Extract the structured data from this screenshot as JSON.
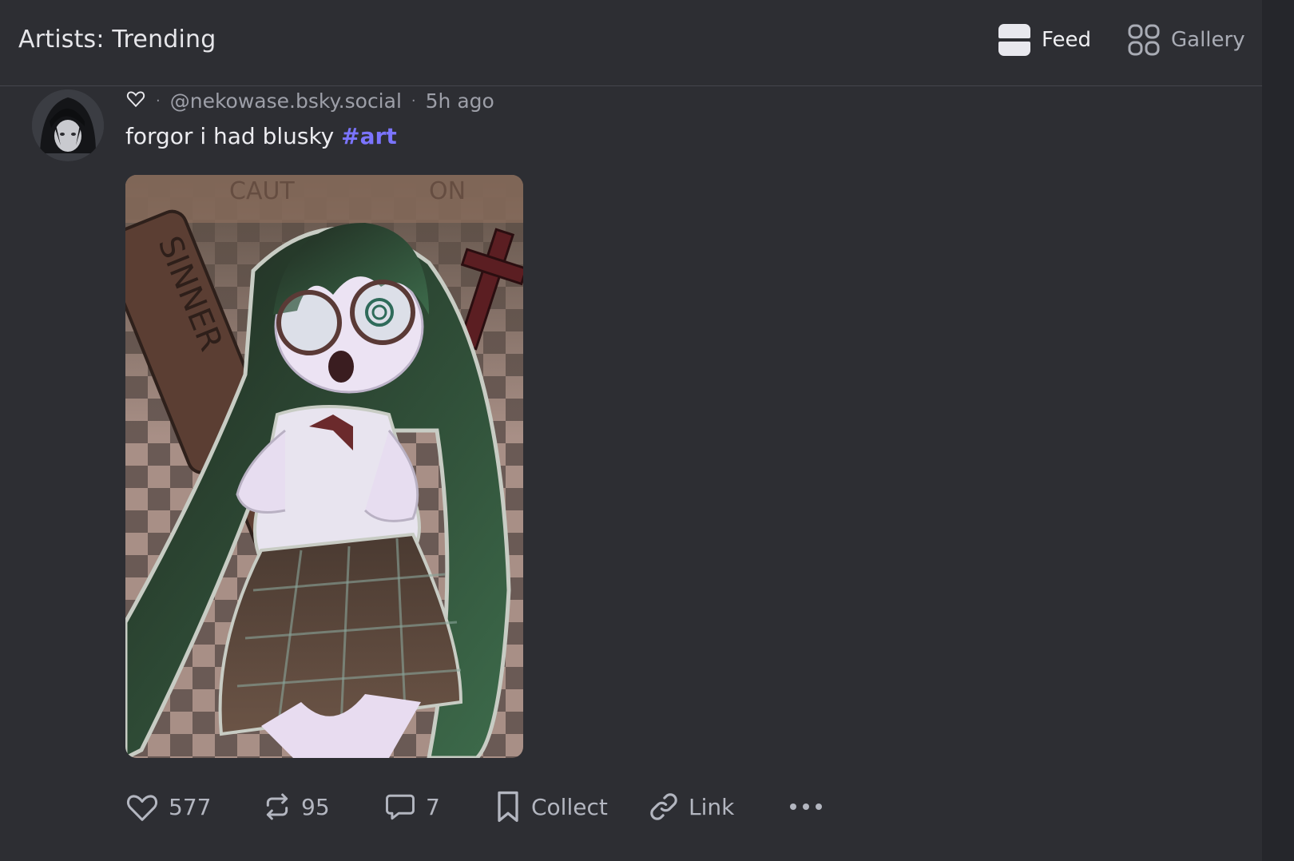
{
  "header": {
    "title": "Artists: Trending",
    "tabs": [
      {
        "label": "Feed",
        "icon": "feed-icon",
        "active": true
      },
      {
        "label": "Gallery",
        "icon": "gallery-icon",
        "active": false
      }
    ]
  },
  "post": {
    "avatar_icon": "avatar",
    "display_name_icon": "heart-outline-icon",
    "handle": "@nekowase.bsky.social",
    "separator": "·",
    "time": "5h ago",
    "text": "forgor i had blusky",
    "hashtag": "#art",
    "image_icon": "illustration",
    "actions": {
      "like_count": "577",
      "repost_count": "95",
      "reply_count": "7",
      "collect_label": "Collect",
      "link_label": "Link"
    }
  },
  "colors": {
    "background": "#2d2e33",
    "accent": "#7b74ff",
    "muted_text": "#9d9fa8"
  }
}
